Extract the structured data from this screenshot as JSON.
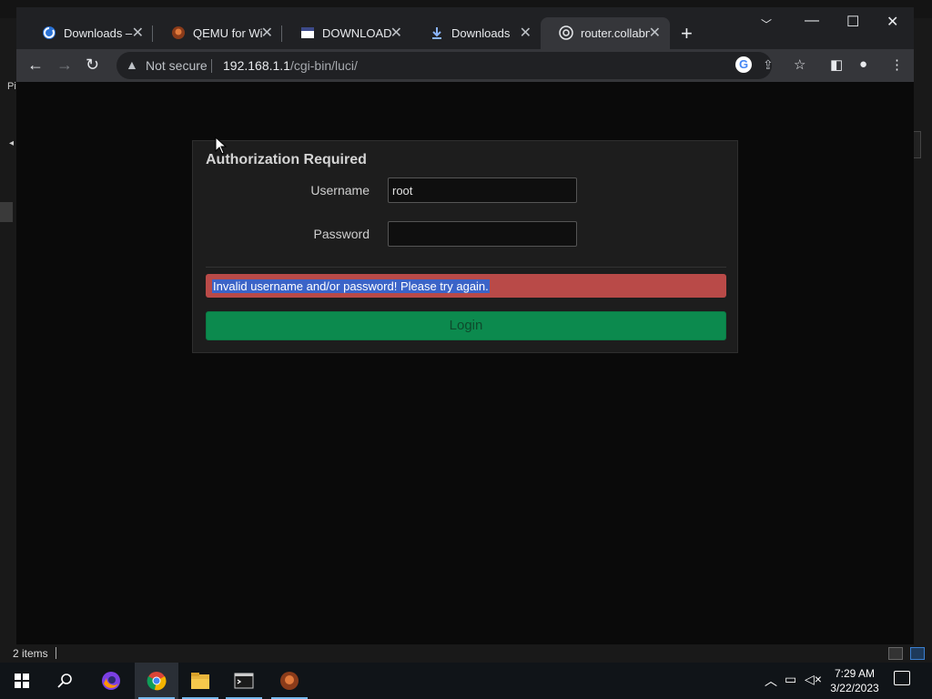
{
  "background_window": {
    "left_label": "Pi",
    "status_count": "2 items"
  },
  "tabs": [
    {
      "label": "Downloads – L",
      "icon": "downloads-site-icon",
      "active": false
    },
    {
      "label": "QEMU for Win",
      "icon": "qemu-icon",
      "active": false
    },
    {
      "label": "DOWNLOADIN",
      "icon": "download-page-icon",
      "active": false
    },
    {
      "label": "Downloads",
      "icon": "chrome-downloads-icon",
      "active": false
    },
    {
      "label": "router.collabne",
      "icon": "router-globe-icon",
      "active": true
    }
  ],
  "omnibox": {
    "security_label": "Not secure",
    "url_host": "192.168.1.1",
    "url_path": "/cgi-bin/luci/"
  },
  "auth": {
    "title": "Authorization Required",
    "username_label": "Username",
    "username_value": "root",
    "password_label": "Password",
    "password_value": "",
    "error_message": "Invalid username and/or password! Please try again.",
    "login_label": "Login"
  },
  "colors": {
    "error_bg": "#b94a48",
    "login_bg": "#0c8a4e",
    "panel_bg": "#1d1d1d"
  },
  "taskbar": {
    "apps": [
      "start-icon",
      "search-icon",
      "firefox-icon",
      "chrome-icon",
      "file-explorer-icon",
      "terminal-icon",
      "qemu-icon"
    ],
    "time": "7:29 AM",
    "date": "3/22/2023"
  }
}
